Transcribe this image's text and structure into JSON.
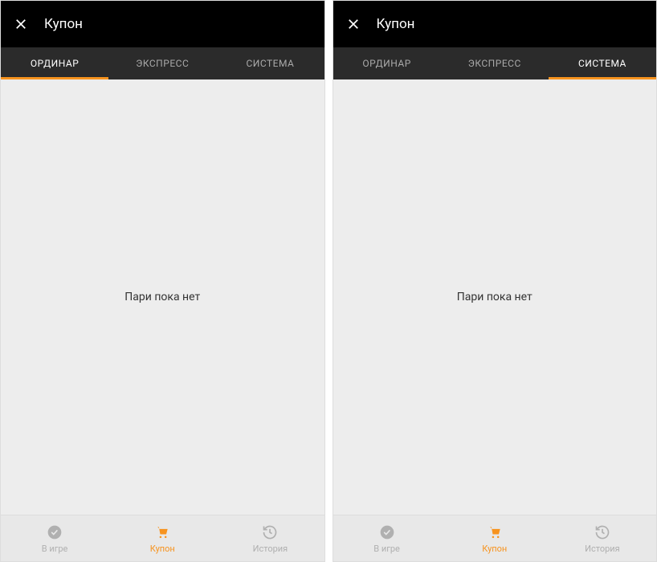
{
  "left": {
    "header": {
      "title": "Купон"
    },
    "tabs": [
      {
        "label": "ОРДИНАР",
        "active": true
      },
      {
        "label": "ЭКСПРЕСС",
        "active": false
      },
      {
        "label": "СИСТЕМА",
        "active": false
      }
    ],
    "emptyText": "Пари пока нет",
    "bottomNav": [
      {
        "label": "В игре",
        "icon": "check-circle",
        "active": false
      },
      {
        "label": "Купон",
        "icon": "cart",
        "active": true
      },
      {
        "label": "История",
        "icon": "history",
        "active": false
      }
    ]
  },
  "right": {
    "header": {
      "title": "Купон"
    },
    "tabs": [
      {
        "label": "ОРДИНАР",
        "active": false
      },
      {
        "label": "ЭКСПРЕСС",
        "active": false
      },
      {
        "label": "СИСТЕМА",
        "active": true
      }
    ],
    "emptyText": "Пари пока нет",
    "bottomNav": [
      {
        "label": "В игре",
        "icon": "check-circle",
        "active": false
      },
      {
        "label": "Купон",
        "icon": "cart",
        "active": true
      },
      {
        "label": "История",
        "icon": "history",
        "active": false
      }
    ]
  }
}
